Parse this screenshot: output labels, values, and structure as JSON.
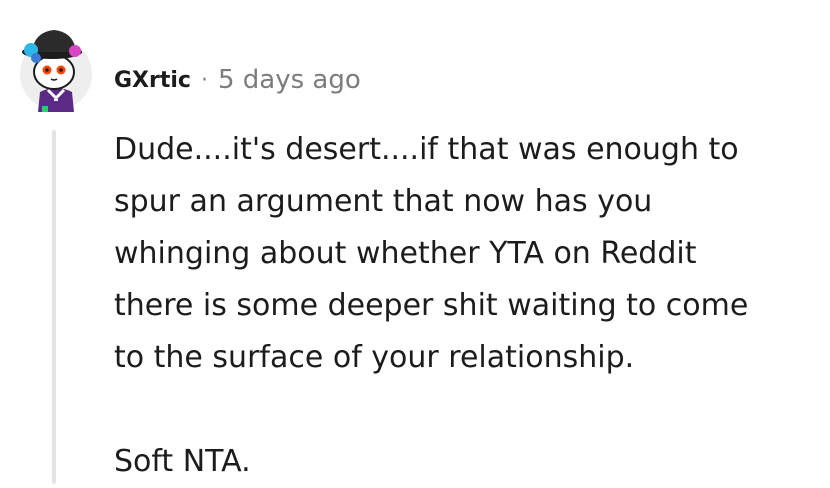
{
  "comment": {
    "author": "GXrtic",
    "separator": "·",
    "timestamp": "5 days ago",
    "avatar_icon": "snoo-avatar-icon",
    "paragraphs": [
      "Dude....it's desert....if that was enough to\nspur an argument that now has you\nwhinging about whether YTA on Reddit\nthere is some deeper shit waiting to come\nto the surface of your relationship.",
      "Soft NTA."
    ]
  },
  "colors": {
    "text": "#1c1c1c",
    "meta": "#7c7c7c",
    "thread_line": "#e4e4e4"
  }
}
